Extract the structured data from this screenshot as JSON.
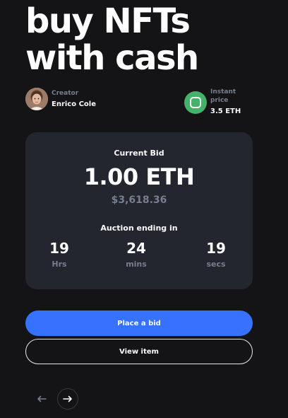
{
  "hero": {
    "title_line1": "buy NFTs",
    "title_line2": "with cash"
  },
  "creator": {
    "label": "Creator",
    "name": "Enrico Cole",
    "avatar_icon": "avatar-photo"
  },
  "instant_price": {
    "label": "Instant price",
    "value": "3.5 ETH",
    "icon": "rounded-square-icon",
    "icon_color": "#45b26b"
  },
  "bid_card": {
    "current_bid_label": "Current Bid",
    "current_bid_eth": "1.00 ETH",
    "current_bid_usd": "$3,618.36",
    "auction_label": "Auction ending in",
    "timer": [
      {
        "value": "19",
        "unit": "Hrs"
      },
      {
        "value": "24",
        "unit": "mins"
      },
      {
        "value": "19",
        "unit": "secs"
      }
    ]
  },
  "actions": {
    "place_bid": "Place a bid",
    "view_item": "View item"
  },
  "navigation": {
    "prev_icon": "arrow-left-icon",
    "next_icon": "arrow-right-icon"
  },
  "colors": {
    "background": "#141416",
    "card": "#23262f",
    "primary": "#3772ff",
    "muted": "#777e90",
    "success": "#45b26b"
  }
}
